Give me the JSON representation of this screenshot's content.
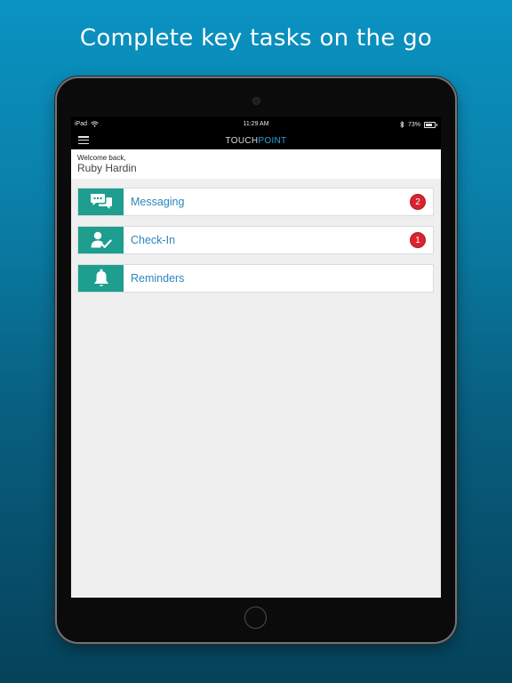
{
  "headline": "Complete key tasks on the go",
  "statusbar": {
    "device": "iPad",
    "time": "11:29 AM",
    "battery": "73%",
    "battery_level": 0.73,
    "icons": [
      "wifi-icon",
      "bluetooth-icon",
      "battery-icon"
    ]
  },
  "navbar": {
    "brand_part1": "TOUCH",
    "brand_part2": "POINT",
    "brand_accent_color": "#2aa3dc",
    "menu_icon": "hamburger-menu-icon"
  },
  "welcome": {
    "greeting": "Welcome back,",
    "user_name": "Ruby Hardin"
  },
  "menu": [
    {
      "label": "Messaging",
      "icon": "chat-bubbles-icon",
      "badge": "2"
    },
    {
      "label": "Check-In",
      "icon": "user-check-icon",
      "badge": "1"
    },
    {
      "label": "Reminders",
      "icon": "bell-icon",
      "badge": ""
    }
  ],
  "colors": {
    "tile_icon_bg": "#1d9e8e",
    "tile_label": "#2b86bd",
    "badge_bg": "#d9232e"
  }
}
